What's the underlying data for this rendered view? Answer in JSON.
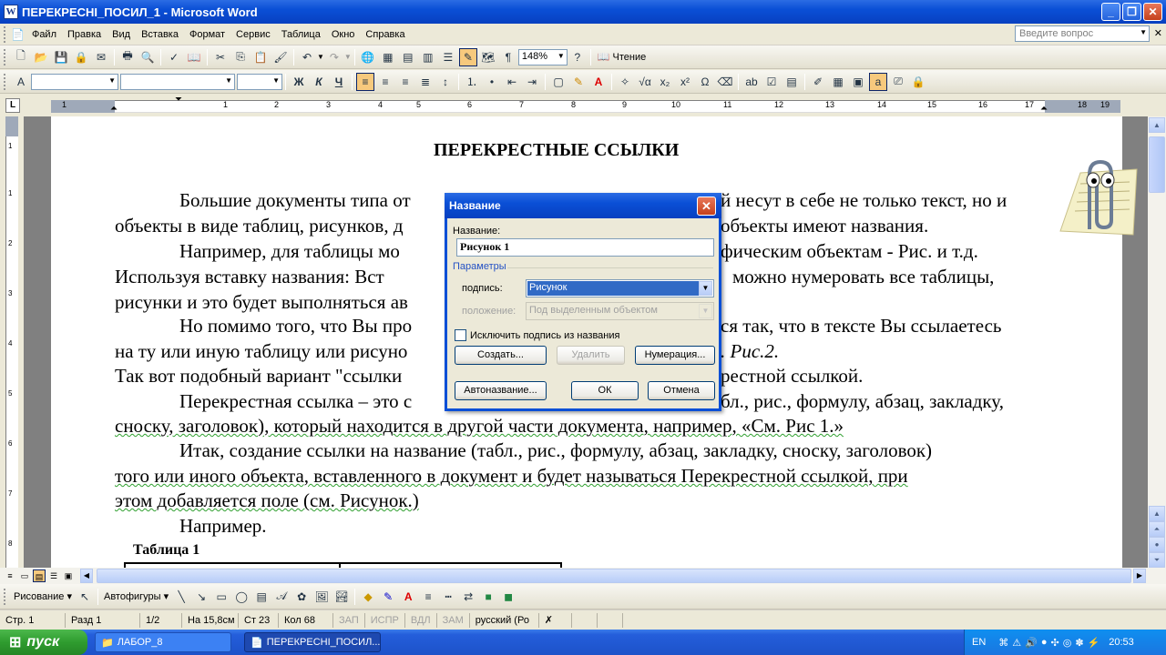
{
  "window": {
    "title": "ПЕРЕКРЕСНІ_ПОСИЛ_1 - Microsoft Word",
    "app_icon": "W"
  },
  "menu": {
    "items": [
      "Файл",
      "Правка",
      "Вид",
      "Вставка",
      "Формат",
      "Сервис",
      "Таблица",
      "Окно",
      "Справка"
    ],
    "help_placeholder": "Введите вопрос"
  },
  "toolbar": {
    "zoom": "148%",
    "reading_label": "Чтение"
  },
  "ruler": {
    "numbers": [
      "1",
      "1",
      "2",
      "3",
      "4",
      "5",
      "6",
      "7",
      "8",
      "9",
      "10",
      "11",
      "12",
      "13",
      "14",
      "15",
      "16",
      "17",
      "18",
      "19"
    ]
  },
  "vruler": {
    "numbers": [
      "1",
      "1",
      "2",
      "3",
      "4",
      "5",
      "6",
      "7",
      "8"
    ]
  },
  "document": {
    "title": "ПЕРЕКРЕСТНЫЕ ССЫЛКИ",
    "lines": [
      "Большие документы типа от",
      "й несут в себе не только текст, но и",
      "объекты в виде таблиц, рисунков, д",
      "объекты имеют названия.",
      "Например, для таблицы мо",
      "фическим объектам - Рис. и т.д.",
      "Используя вставку названия: Вст",
      "можно нумеровать все таблицы,",
      "рисунки и это будет выполняться ав",
      "Но помимо того, что Вы про",
      "ся так, что в тексте Вы ссылаетесь",
      "на ту или иную таблицу или рисуно",
      ". Рис.2.",
      "Так вот подобный вариант \"ссылки",
      "рестной ссылкой.",
      "Перекрестная ссылка – это с",
      "бл., рис., формулу, абзац, закладку,",
      "сноску, заголовок), который находится в другой части документа, например, «См. Рис 1.»",
      "Итак, создание ссылки на название (табл., рис., формулу, абзац, закладку, сноску, заголовок)",
      "того или иного объекта, вставленного в документ и будет называться Перекрестной ссылкой, при",
      "этом добавляется поле (см. Рисунок.)",
      "Например.",
      "Таблица 1"
    ]
  },
  "dialog": {
    "title": "Название",
    "name_label": "Название:",
    "name_value": "Рисунок 1",
    "params_label": "Параметры",
    "caption_label": "подпись:",
    "caption_value": "Рисунок",
    "position_label": "положение:",
    "position_value": "Под выделенным объектом",
    "exclude_label": "Исключить подпись из названия",
    "btn_create": "Создать...",
    "btn_delete": "Удалить",
    "btn_numbering": "Нумерация...",
    "btn_autocaption": "Автоназвание...",
    "btn_ok": "ОК",
    "btn_cancel": "Отмена"
  },
  "drawbar": {
    "drawing": "Рисование",
    "autoshapes": "Автофигуры"
  },
  "status": {
    "page": "Стр. 1",
    "section": "Разд 1",
    "pages": "1/2",
    "at": "На 15,8см",
    "line": "Ст 23",
    "col": "Кол 68",
    "rec": "ЗАП",
    "trk": "ИСПР",
    "ext": "ВДЛ",
    "ovr": "ЗАМ",
    "lang": "русский (Ро"
  },
  "taskbar": {
    "start": "пуск",
    "tasks": [
      "ЛАБОР_8",
      "ПЕРЕКРЕСНІ_ПОСИЛ..."
    ],
    "lang": "EN",
    "clock": "20:53"
  }
}
